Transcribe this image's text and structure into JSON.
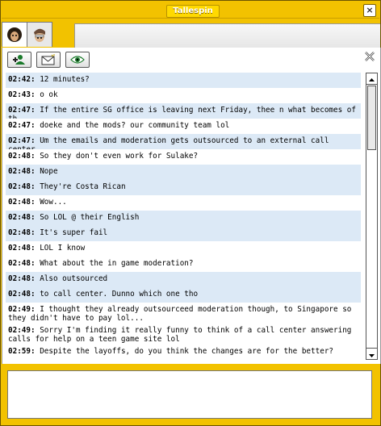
{
  "window": {
    "title": "Tallespin"
  },
  "tabs": [
    {
      "name": "friend-avatar-1"
    },
    {
      "name": "friend-avatar-2"
    }
  ],
  "toolbar": {
    "buttons": [
      {
        "icon": "add-friend-icon"
      },
      {
        "icon": "mail-icon"
      },
      {
        "icon": "eye-icon"
      }
    ]
  },
  "messages": [
    {
      "time": "02:42:",
      "text": " 12 minutes?"
    },
    {
      "time": "02:43:",
      "text": " o ok"
    },
    {
      "time": "02:47:",
      "text": " If the entire SG office is leaving next Friday, thee n what becomes of th"
    },
    {
      "time": "02:47:",
      "text": " doeke and the mods? our community team lol"
    },
    {
      "time": "02:47:",
      "text": " Um the emails and moderation gets outsourced to an external call center"
    },
    {
      "time": "02:48:",
      "text": " So they don't even work for Sulake?"
    },
    {
      "time": "02:48:",
      "text": " Nope"
    },
    {
      "time": "02:48:",
      "text": " They're Costa Rican"
    },
    {
      "time": "02:48:",
      "text": " Wow..."
    },
    {
      "time": "02:48:",
      "text": " So LOL @ their English"
    },
    {
      "time": "02:48:",
      "text": " It's super fail"
    },
    {
      "time": "02:48:",
      "text": " LOL I know"
    },
    {
      "time": "02:48:",
      "text": " What about the in game moderation?"
    },
    {
      "time": "02:48:",
      "text": " Also outsourced"
    },
    {
      "time": "02:48:",
      "text": " to call center. Dunno which one tho"
    },
    {
      "time": "02:49:",
      "text": " I thought they already outsourceed moderation though, to Singapore so they didn't have to pay lol..."
    },
    {
      "time": "02:49:",
      "text": " Sorry I'm finding it really funny to think of a call center answering calls for help on a teen game site lol"
    },
    {
      "time": "02:59:",
      "text": " Despite the layoffs, do you think the changes are for the better?"
    }
  ],
  "input": {
    "value": "",
    "placeholder": ""
  },
  "colors": {
    "frame": "#f2c200",
    "row_highlight": "#dce9f6"
  }
}
